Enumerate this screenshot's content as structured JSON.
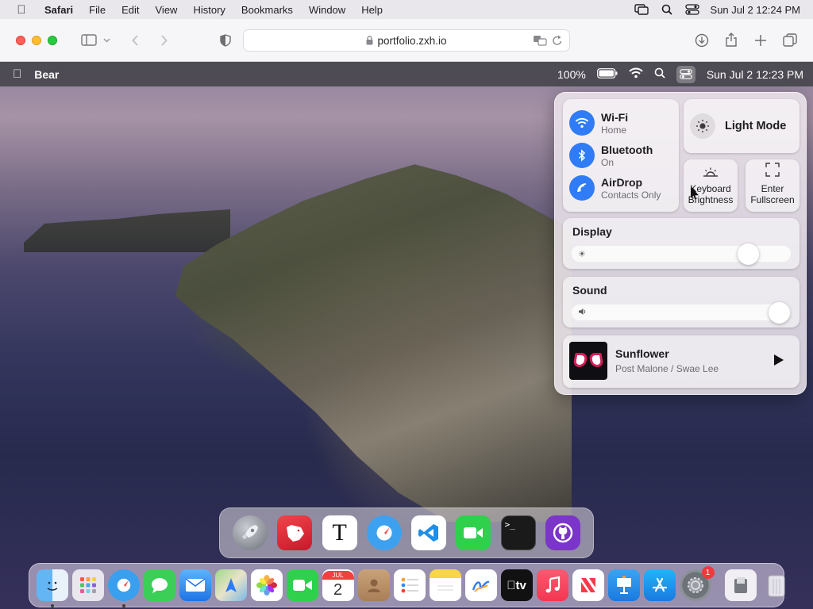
{
  "host_menubar": {
    "app_name": "Safari",
    "menus": [
      "File",
      "Edit",
      "View",
      "History",
      "Bookmarks",
      "Window",
      "Help"
    ],
    "clock": "Sun Jul 2  12:24 PM"
  },
  "safari": {
    "url": "portfolio.zxh.io"
  },
  "portfolio": {
    "menubar": {
      "app_name": "Bear",
      "battery": "100%",
      "clock": "Sun Jul 2 12:23 PM"
    },
    "control_center": {
      "network": [
        {
          "title": "Wi-Fi",
          "status": "Home",
          "icon": "wifi-icon"
        },
        {
          "title": "Bluetooth",
          "status": "On",
          "icon": "bluetooth-icon"
        },
        {
          "title": "AirDrop",
          "status": "Contacts Only",
          "icon": "airdrop-icon"
        }
      ],
      "light_mode_label": "Light Mode",
      "keyboard_brightness_label_1": "Keyboard",
      "keyboard_brightness_label_2": "Brightness",
      "fullscreen_label_1": "Enter",
      "fullscreen_label_2": "Fullscreen",
      "display": {
        "label": "Display",
        "level": 0.8
      },
      "sound": {
        "label": "Sound",
        "level": 0.94
      },
      "now_playing": {
        "song": "Sunflower",
        "artist": "Post Malone / Swae Lee"
      }
    },
    "dock_apps": [
      "Launchpad",
      "Bear",
      "Typora",
      "Safari",
      "VSCode",
      "FaceTime",
      "Terminal",
      "GitHub"
    ]
  },
  "host_dock": {
    "apps": [
      "Finder",
      "Launchpad",
      "Safari",
      "Messages",
      "Mail",
      "Maps",
      "Photos",
      "FaceTime",
      "Calendar",
      "Contacts",
      "Reminders",
      "Notes",
      "Freeform",
      "TV",
      "Music",
      "News",
      "Keynote",
      "App Store",
      "System Settings"
    ],
    "calendar_month": "JUL",
    "calendar_day": "2",
    "settings_badge": "1",
    "tv_label": "tv"
  },
  "colors": {
    "accent_blue": "#2f7cf6",
    "close": "#fe5f57",
    "minimize": "#febc2e",
    "zoom": "#28c840"
  }
}
